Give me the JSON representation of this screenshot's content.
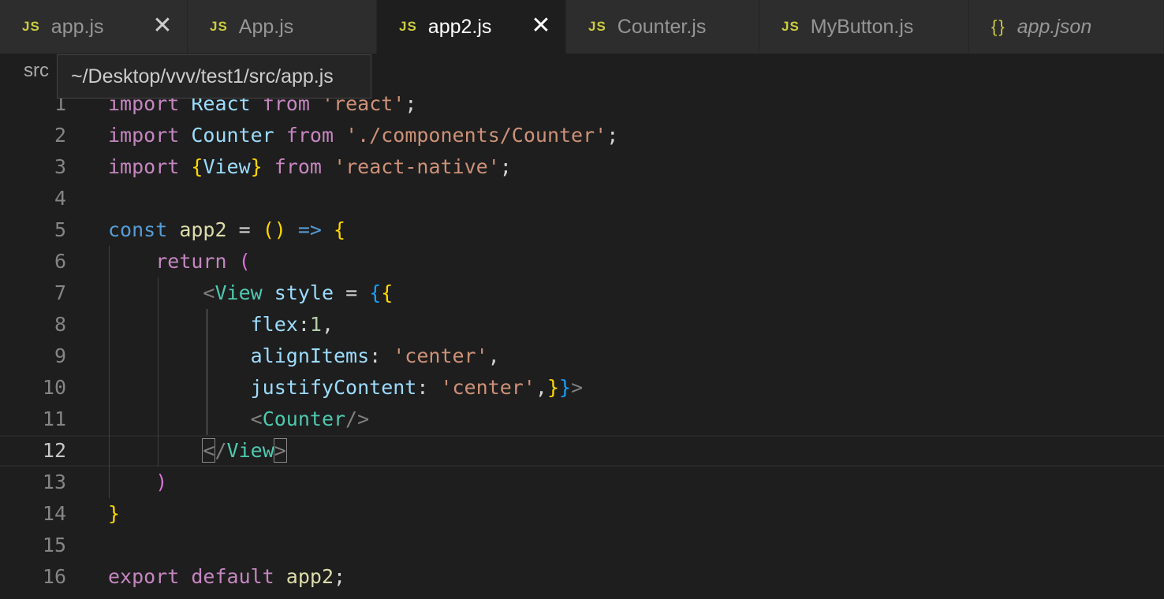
{
  "tabs": [
    {
      "icon": "JS",
      "label": "app.js",
      "active": false,
      "close": "✕"
    },
    {
      "icon": "JS",
      "label": "App.js",
      "active": false
    },
    {
      "icon": "JS",
      "label": "app2.js",
      "active": true,
      "close": "✕"
    },
    {
      "icon": "JS",
      "label": "Counter.js",
      "active": false
    },
    {
      "icon": "JS",
      "label": "MyButton.js",
      "active": false
    },
    {
      "icon": "{}",
      "label": "app.json",
      "active": false
    }
  ],
  "breadcrumb": {
    "segment": "src"
  },
  "tooltip": {
    "path": "~/Desktop/vvv/test1/src/app.js"
  },
  "editor": {
    "current_line": 12,
    "line_numbers": [
      "1",
      "2",
      "3",
      "4",
      "5",
      "6",
      "7",
      "8",
      "9",
      "10",
      "11",
      "12",
      "13",
      "14",
      "15",
      "16"
    ],
    "lines": [
      [
        [
          "kw",
          "import"
        ],
        [
          "punc",
          " "
        ],
        [
          "var",
          "React"
        ],
        [
          "punc",
          " "
        ],
        [
          "kw",
          "from"
        ],
        [
          "punc",
          " "
        ],
        [
          "str",
          "'react'"
        ],
        [
          "punc",
          ";"
        ]
      ],
      [
        [
          "kw",
          "import"
        ],
        [
          "punc",
          " "
        ],
        [
          "var",
          "Counter"
        ],
        [
          "punc",
          " "
        ],
        [
          "kw",
          "from"
        ],
        [
          "punc",
          " "
        ],
        [
          "str",
          "'./components/Counter'"
        ],
        [
          "punc",
          ";"
        ]
      ],
      [
        [
          "kw",
          "import"
        ],
        [
          "punc",
          " "
        ],
        [
          "br1",
          "{"
        ],
        [
          "var",
          "View"
        ],
        [
          "br1",
          "}"
        ],
        [
          "punc",
          " "
        ],
        [
          "kw",
          "from"
        ],
        [
          "punc",
          " "
        ],
        [
          "str",
          "'react-native'"
        ],
        [
          "punc",
          ";"
        ]
      ],
      [],
      [
        [
          "st",
          "const"
        ],
        [
          "punc",
          " "
        ],
        [
          "fn",
          "app2"
        ],
        [
          "punc",
          " = "
        ],
        [
          "br1",
          "()"
        ],
        [
          "punc",
          " "
        ],
        [
          "st",
          "=>"
        ],
        [
          "punc",
          " "
        ],
        [
          "br1",
          "{"
        ]
      ],
      [
        [
          "punc",
          "    "
        ],
        [
          "kw",
          "return"
        ],
        [
          "punc",
          " "
        ],
        [
          "br2",
          "("
        ]
      ],
      [
        [
          "punc",
          "        "
        ],
        [
          "tag",
          "<"
        ],
        [
          "cls",
          "View"
        ],
        [
          "punc",
          " "
        ],
        [
          "var",
          "style"
        ],
        [
          "punc",
          " = "
        ],
        [
          "br3",
          "{"
        ],
        [
          "br1",
          "{"
        ]
      ],
      [
        [
          "punc",
          "            "
        ],
        [
          "var",
          "flex"
        ],
        [
          "punc",
          ":"
        ],
        [
          "num",
          "1"
        ],
        [
          "punc",
          ","
        ]
      ],
      [
        [
          "punc",
          "            "
        ],
        [
          "var",
          "alignItems"
        ],
        [
          "punc",
          ": "
        ],
        [
          "str",
          "'center'"
        ],
        [
          "punc",
          ","
        ]
      ],
      [
        [
          "punc",
          "            "
        ],
        [
          "var",
          "justifyContent"
        ],
        [
          "punc",
          ": "
        ],
        [
          "str",
          "'center'"
        ],
        [
          "punc",
          ","
        ],
        [
          "br1",
          "}"
        ],
        [
          "br3",
          "}"
        ],
        [
          "tag",
          ">"
        ]
      ],
      [
        [
          "punc",
          "            "
        ],
        [
          "tag",
          "<"
        ],
        [
          "cls",
          "Counter"
        ],
        [
          "tag",
          "/>"
        ]
      ],
      [
        [
          "punc",
          "        "
        ],
        [
          "tag",
          "<"
        ],
        [
          "tag",
          "/"
        ],
        [
          "cls",
          "View"
        ],
        [
          "tag",
          ">"
        ]
      ],
      [
        [
          "punc",
          "    "
        ],
        [
          "br2",
          ")"
        ]
      ],
      [
        [
          "br1",
          "}"
        ]
      ],
      [],
      [
        [
          "kw",
          "export"
        ],
        [
          "punc",
          " "
        ],
        [
          "kw",
          "default"
        ],
        [
          "punc",
          " "
        ],
        [
          "fn",
          "app2"
        ],
        [
          "punc",
          ";"
        ]
      ]
    ]
  }
}
